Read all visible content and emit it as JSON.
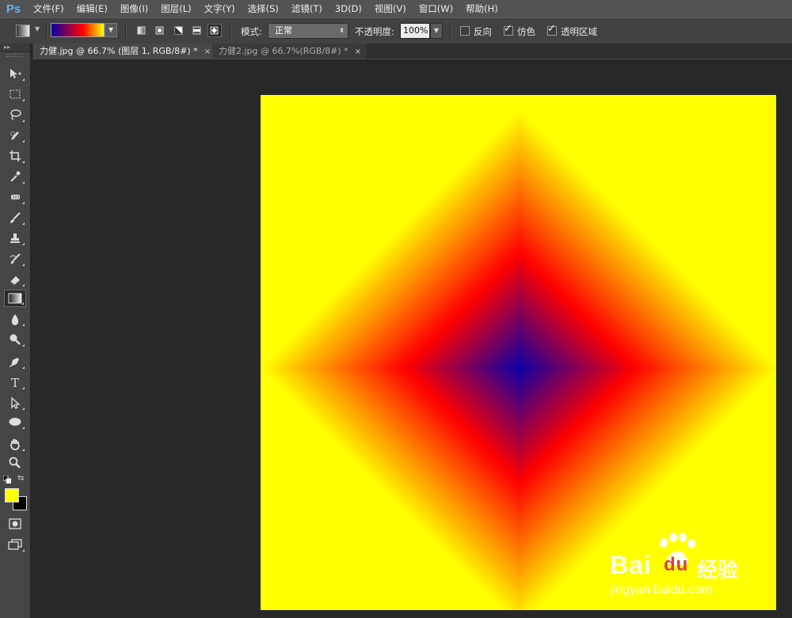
{
  "app": {
    "logo": "Ps"
  },
  "menu": [
    "文件(F)",
    "编辑(E)",
    "图像(I)",
    "图层(L)",
    "文字(Y)",
    "选择(S)",
    "滤镜(T)",
    "3D(D)",
    "视图(V)",
    "窗口(W)",
    "帮助(H)"
  ],
  "options": {
    "gradient_colors": [
      "#0a00a8",
      "#ff0000",
      "#ffff00"
    ],
    "gradient_types": [
      "linear-gradient-icon",
      "radial-gradient-icon",
      "angle-gradient-icon",
      "reflected-gradient-icon",
      "diamond-gradient-icon"
    ],
    "selected_type": "diamond-gradient-icon",
    "mode_label": "模式:",
    "mode_value": "正常",
    "opacity_label": "不透明度:",
    "opacity_value": "100%",
    "reverse_label": "反向",
    "reverse_checked": false,
    "dither_label": "仿色",
    "dither_checked": true,
    "transparency_label": "透明区域",
    "transparency_checked": true
  },
  "tabs": [
    {
      "label": "力健.jpg @ 66.7% (图层 1, RGB/8#) *",
      "active": true
    },
    {
      "label": "力健2.jpg @ 66.7%(RGB/8#) *",
      "active": false
    }
  ],
  "tools": [
    "move-tool-icon",
    "marquee-tool-icon",
    "lasso-tool-icon",
    "quick-selection-tool-icon",
    "crop-tool-icon",
    "eyedropper-tool-icon",
    "healing-brush-tool-icon",
    "brush-tool-icon",
    "clone-stamp-tool-icon",
    "history-brush-tool-icon",
    "eraser-tool-icon",
    "gradient-tool-icon",
    "blur-tool-icon",
    "dodge-tool-icon",
    "pen-tool-icon",
    "type-tool-icon",
    "path-selection-tool-icon",
    "ellipse-tool-icon",
    "hand-tool-icon",
    "zoom-tool-icon"
  ],
  "selected_tool": "gradient-tool-icon",
  "colors": {
    "foreground": "#ffff00",
    "background": "#000000",
    "gradient_center": "#0a00a8",
    "gradient_mid": "#ff0000",
    "gradient_outer": "#ffff00"
  },
  "watermark": {
    "brand": "Bai",
    "paw": "du",
    "cn": "经验",
    "url": "jingyan.baidu.com"
  }
}
